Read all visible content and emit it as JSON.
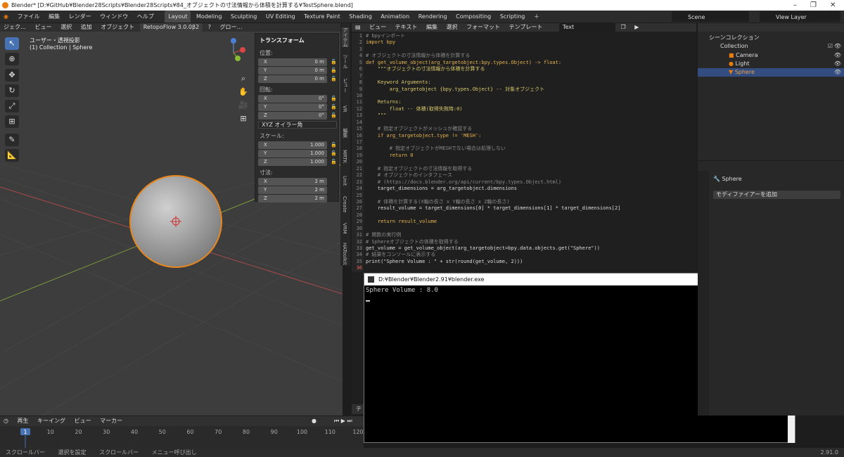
{
  "window": {
    "title": "Blender* [D:¥GitHub¥Blender28Scripts¥Blender28Scripts¥84_オブジェクトの寸法情報から体積を計算する¥TestSphere.blend]"
  },
  "menu": [
    "ファイル",
    "編集",
    "レンダー",
    "ウィンドウ",
    "ヘルプ"
  ],
  "workspaces": [
    "Layout",
    "Modeling",
    "Sculpting",
    "UV Editing",
    "Texture Paint",
    "Shading",
    "Animation",
    "Rendering",
    "Compositing",
    "Scripting"
  ],
  "active_workspace": "Layout",
  "scene": "Scene",
  "view_layer": "View Layer",
  "viewport": {
    "header": [
      "ジェク…",
      "ビュー",
      "選択",
      "追加",
      "オブジェクト",
      "RetopoFlow 3.0.0β2",
      "グロー…"
    ],
    "title": "ユーザー・透視投影",
    "subtitle": "(1) Collection | Sphere"
  },
  "npanel": {
    "header": "トランスフォーム",
    "location_label": "位置:",
    "location": [
      {
        "axis": "X",
        "value": "0 m"
      },
      {
        "axis": "Y",
        "value": "0 m"
      },
      {
        "axis": "Z",
        "value": "0 m"
      }
    ],
    "rotation_label": "回転:",
    "rotation": [
      {
        "axis": "X",
        "value": "0°"
      },
      {
        "axis": "Y",
        "value": "0°"
      },
      {
        "axis": "Z",
        "value": "0°"
      }
    ],
    "rotation_mode": "XYZ オイラー角",
    "scale_label": "スケール:",
    "scale": [
      {
        "axis": "X",
        "value": "1.000"
      },
      {
        "axis": "Y",
        "value": "1.000"
      },
      {
        "axis": "Z",
        "value": "1.000"
      }
    ],
    "dimensions_label": "寸法:",
    "dimensions": [
      {
        "axis": "X",
        "value": "2 m"
      },
      {
        "axis": "Y",
        "value": "2 m"
      },
      {
        "axis": "Z",
        "value": "2 m"
      }
    ]
  },
  "side_tabs": [
    "アイテム",
    "ツール",
    "ビュー",
    "VR",
    "編集",
    "MRTK",
    "Unit",
    "Create",
    "VRM",
    "HAToolkit"
  ],
  "text_editor": {
    "header": [
      "ビュー",
      "テキスト",
      "編集",
      "選択",
      "フォーマット",
      "テンプレート"
    ],
    "text_name": "Text",
    "tab_label": "テキ"
  },
  "code_lines": [
    "# bpyインポート",
    "import bpy",
    "",
    "# オブジェクトの寸法情報から体積を計算する",
    "def get_volume_object(arg_targetobject:bpy.types.Object) -> float:",
    "    \"\"\"オブジェクトの寸法情報から体積を計算する",
    "",
    "    Keyword Arguments:",
    "        arg_targetobject {bpy.types.Object} -- 対象オブジェクト",
    "",
    "    Returns:",
    "        float -- 体積(取得失敗時:0)",
    "    \"\"\"",
    "",
    "    # 指定オブジェクトがメッシュか確認する",
    "    if arg_targetobject.type != 'MESH':",
    "",
    "        # 指定オブジェクトがMESHでない場合は処理しない",
    "        return 0",
    "",
    "    # 指定オブジェクトの寸法情報を取得する",
    "    # オブジェクトのインタフェース",
    "    # (https://docs.blender.org/api/current/bpy.types.Object.html)",
    "    target_dimensions = arg_targetobject.dimensions",
    "",
    "    # 体積を計算する(X軸の長さ x Y軸の長さ x Z軸の長さ)",
    "    result_volume = target_dimensions[0] * target_dimensions[1] * target_dimensions[2]",
    "",
    "    return result_volume",
    "",
    "# 関数の実行例",
    "# Sphereオブジェクトの体積を取得する",
    "get_volume = get_volume_object(arg_targetobject=bpy.data.objects.get(\"Sphere\"))",
    "# 結果をコンソールに表示する",
    "print(\"Sphere Volume : \" + str(round(get_volume, 2)))",
    ""
  ],
  "console": {
    "title": "D:¥Blender¥Blender2.91¥blender.exe",
    "output": "Sphere Volume : 8.0"
  },
  "outliner": {
    "root": "シーンコレクション",
    "collection": "Collection",
    "items": [
      "Camera",
      "Light",
      "Sphere"
    ],
    "selected": "Sphere"
  },
  "properties": {
    "object": "Sphere",
    "add_modifier": "モディファイアーを追加"
  },
  "timeline": {
    "header": [
      "再生",
      "キーイング",
      "ビュー",
      "マーカー"
    ],
    "frames": [
      "1",
      "10",
      "20",
      "30",
      "40",
      "50",
      "60",
      "70",
      "80",
      "90",
      "100",
      "110",
      "120"
    ],
    "current_frame": 1
  },
  "status": {
    "items": [
      "スクロールバー",
      "選択を設定",
      "スクロールバー",
      "メニュー呼び出し"
    ],
    "version": "2.91.0"
  },
  "colors": {
    "accent": "#4772b3",
    "selected_outline": "#e8871e",
    "console_bg": "#000000"
  }
}
